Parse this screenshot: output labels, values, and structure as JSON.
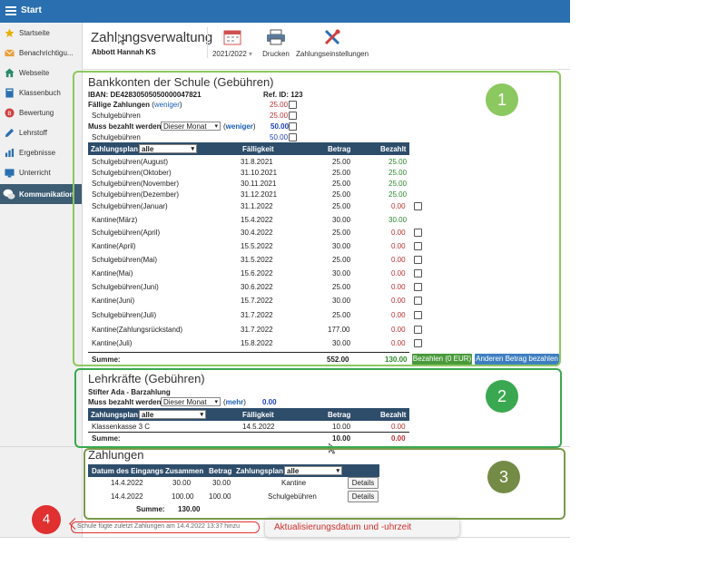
{
  "topbar": {
    "title": "Start"
  },
  "sidebar": {
    "items": [
      {
        "label": "Startseite",
        "icon": "star-icon",
        "color": "#e8b000"
      },
      {
        "label": "Benachrichtigu...",
        "icon": "envelope-icon",
        "color": "#e8a040"
      },
      {
        "label": "Webseite",
        "icon": "house-icon",
        "color": "#2a8a6a"
      },
      {
        "label": "Klassenbuch",
        "icon": "book-icon",
        "color": "#2a6fb0"
      },
      {
        "label": "Bewertung",
        "icon": "grade-icon",
        "color": "#d04040"
      },
      {
        "label": "Lehrstoff",
        "icon": "pencil-icon",
        "color": "#2a6fb0"
      },
      {
        "label": "Ergebnisse",
        "icon": "chart-icon",
        "color": "#2a6fb0"
      },
      {
        "label": "Unterricht",
        "icon": "lesson-icon",
        "color": "#2a6fb0"
      },
      {
        "label": "Kommunikation",
        "icon": "chat-icon",
        "color": "#ffffff"
      }
    ]
  },
  "header": {
    "title": "Zahlungsverwaltung",
    "user": "Abbott Hannah KS",
    "toolbar": {
      "year": "2021/2022",
      "print": "Drucken",
      "settings": "Zahlungseinstellungen"
    }
  },
  "callouts": {
    "b1": "1",
    "b2": "2",
    "b3": "3",
    "b4": "4"
  },
  "school": {
    "title": "Bankkonten der Schule (Gebühren)",
    "iban_label": "IBAN: DE42830505050000047821",
    "ref_label": "Ref. ID: 123",
    "due_label": "Fällige Zahlungen",
    "less": "weniger",
    "due_amount": "25.00",
    "due_sub_label": "Schulgebühren",
    "due_sub_amount": "25.00",
    "must_label": "Muss bezahlt werden",
    "period": "Dieser Monat",
    "must_amount": "50.00",
    "must_sub_label": "Schulgebühren",
    "must_sub_amount": "50.00",
    "table": {
      "headers": {
        "plan": "Zahlungsplan",
        "filter": "alle",
        "due": "Fälligkeit",
        "amount": "Betrag",
        "paid": "Bezahlt"
      },
      "rows": [
        {
          "name": "Schulgebühren(August)",
          "date": "31.8.2021",
          "amount": "25.00",
          "paid": "25.00",
          "status": "paid",
          "check": false
        },
        {
          "name": "Schulgebühren(Oktober)",
          "date": "31.10.2021",
          "amount": "25.00",
          "paid": "25.00",
          "status": "paid",
          "check": false
        },
        {
          "name": "Schulgebühren(November)",
          "date": "30.11.2021",
          "amount": "25.00",
          "paid": "25.00",
          "status": "paid",
          "check": false
        },
        {
          "name": "Schulgebühren(Dezember)",
          "date": "31.12.2021",
          "amount": "25.00",
          "paid": "25.00",
          "status": "paid",
          "check": false
        },
        {
          "name": "Schulgebühren(Januar)",
          "date": "31.1.2022",
          "amount": "25.00",
          "paid": "0.00",
          "status": "open",
          "check": true
        },
        {
          "name": "Kantine(März)",
          "date": "15.4.2022",
          "amount": "30.00",
          "paid": "30.00",
          "status": "paid",
          "check": false
        },
        {
          "name": "Schulgebühren(April)",
          "date": "30.4.2022",
          "amount": "25.00",
          "paid": "0.00",
          "status": "open",
          "check": true
        },
        {
          "name": "Kantine(April)",
          "date": "15.5.2022",
          "amount": "30.00",
          "paid": "0.00",
          "status": "open",
          "check": true
        },
        {
          "name": "Schulgebühren(Mai)",
          "date": "31.5.2022",
          "amount": "25.00",
          "paid": "0.00",
          "status": "open",
          "check": true
        },
        {
          "name": "Kantine(Mai)",
          "date": "15.6.2022",
          "amount": "30.00",
          "paid": "0.00",
          "status": "open",
          "check": true
        },
        {
          "name": "Schulgebühren(Juni)",
          "date": "30.6.2022",
          "amount": "25.00",
          "paid": "0.00",
          "status": "open",
          "check": true
        },
        {
          "name": "Kantine(Juni)",
          "date": "15.7.2022",
          "amount": "30.00",
          "paid": "0.00",
          "status": "open",
          "check": true
        },
        {
          "name": "Schulgebühren(Juli)",
          "date": "31.7.2022",
          "amount": "25.00",
          "paid": "0.00",
          "status": "open",
          "check": true
        },
        {
          "name": "Kantine(Zahlungsrückstand)",
          "date": "31.7.2022",
          "amount": "177.00",
          "paid": "0.00",
          "status": "open",
          "check": true
        },
        {
          "name": "Kantine(Juli)",
          "date": "15.8.2022",
          "amount": "30.00",
          "paid": "0.00",
          "status": "open",
          "check": true
        }
      ],
      "sum_label": "Summe:",
      "sum_amount": "552.00",
      "sum_paid": "130.00"
    },
    "pay_button": "Bezahlen (0 EUR)",
    "other_button": "Anderen Betrag bezahlen"
  },
  "teachers": {
    "title": "Lehrkräfte (Gebühren)",
    "account": "Stifter Ada - Barzahlung",
    "must_label": "Muss bezahlt werden",
    "period": "Dieser Monat",
    "more": "mehr",
    "must_amount": "0.00",
    "table": {
      "headers": {
        "plan": "Zahlungsplan",
        "filter": "alle",
        "due": "Fälligkeit",
        "amount": "Betrag",
        "paid": "Bezahlt"
      },
      "rows": [
        {
          "name": "Klassenkasse 3 C",
          "date": "14.5.2022",
          "amount": "10.00",
          "paid": "0.00"
        }
      ],
      "sum_label": "Summe:",
      "sum_amount": "10.00",
      "sum_paid": "0.00"
    }
  },
  "payments": {
    "title": "Zahlungen",
    "headers": {
      "date": "Datum des Eingangs",
      "total": "Zusammen",
      "amount": "Betrag",
      "plan": "Zahlungsplan",
      "filter": "alle"
    },
    "rows": [
      {
        "date": "14.4.2022",
        "total": "30.00",
        "amount": "30.00",
        "plan": "Kantine",
        "button": "Details"
      },
      {
        "date": "14.4.2022",
        "total": "100.00",
        "amount": "100.00",
        "plan": "Schulgebühren",
        "button": "Details"
      }
    ],
    "sum_label": "Summe:",
    "sum_total": "130.00"
  },
  "footer": {
    "note": "Schule fügte zuletzt Zahlungen am 14.4.2022 13:37 hinzu",
    "annotation": "Aktualisierungsdatum und -uhrzeit"
  }
}
